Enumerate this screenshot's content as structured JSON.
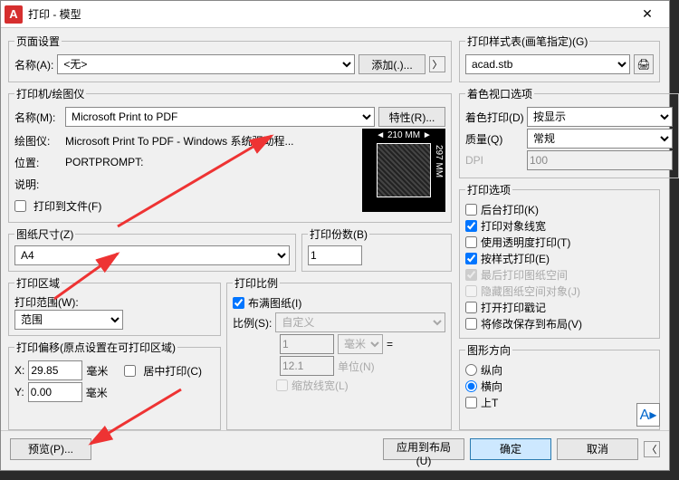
{
  "titlebar": {
    "logo": "A",
    "title": "打印 - 模型",
    "close": "✕"
  },
  "page_setup": {
    "legend": "页面设置",
    "name_label": "名称(A):",
    "name_value": "<无>",
    "add_btn": "添加(.)...",
    "expand": "〉"
  },
  "printer": {
    "legend": "打印机/绘图仪",
    "name_label": "名称(M):",
    "name_value": "Microsoft Print to PDF",
    "props_btn": "特性(R)...",
    "plotter_label": "绘图仪:",
    "plotter_value": "Microsoft Print To PDF - Windows 系统驱动程...",
    "location_label": "位置:",
    "location_value": "PORTPROMPT:",
    "desc_label": "说明:",
    "to_file_label": "打印到文件(F)",
    "preview_top": "210 MM",
    "preview_side": "297 MM"
  },
  "paper": {
    "legend": "图纸尺寸(Z)",
    "value": "A4"
  },
  "copies": {
    "legend": "打印份数(B)",
    "value": "1"
  },
  "area": {
    "legend": "打印区域",
    "scope_label": "打印范围(W):",
    "scope_value": "范围"
  },
  "scale": {
    "legend": "打印比例",
    "fit_label": "布满图纸(I)",
    "ratio_label": "比例(S):",
    "ratio_value": "自定义",
    "unit1_value": "1",
    "unit1_label": "毫米",
    "unit2_value": "12.1",
    "unit2_label": "单位(N)",
    "lineweight_label": "缩放线宽(L)"
  },
  "offset": {
    "legend": "打印偏移(原点设置在可打印区域)",
    "x_label": "X:",
    "x_value": "29.85",
    "y_label": "Y:",
    "y_value": "0.00",
    "unit": "毫米",
    "center_label": "居中打印(C)"
  },
  "styles": {
    "legend": "打印样式表(画笔指定)(G)",
    "value": "acad.stb"
  },
  "viewport": {
    "legend": "着色视口选项",
    "shade_label": "着色打印(D)",
    "shade_value": "按显示",
    "quality_label": "质量(Q)",
    "quality_value": "常规",
    "dpi_label": "DPI",
    "dpi_value": "100"
  },
  "options": {
    "legend": "打印选项",
    "bg_label": "后台打印(K)",
    "lw_label": "打印对象线宽",
    "trans_label": "使用透明度打印(T)",
    "bystyle_label": "按样式打印(E)",
    "paperspace_label": "最后打印图纸空间",
    "hide_label": "隐藏图纸空间对象(J)",
    "stamp_label": "打开打印戳记",
    "save_label": "将修改保存到布局(V)"
  },
  "direction": {
    "legend": "图形方向",
    "portrait": "纵向",
    "landscape": "横向",
    "upside": "上T"
  },
  "footer": {
    "preview": "预览(P)...",
    "apply": "应用到布局(U)",
    "ok": "确定",
    "cancel": "取消"
  }
}
